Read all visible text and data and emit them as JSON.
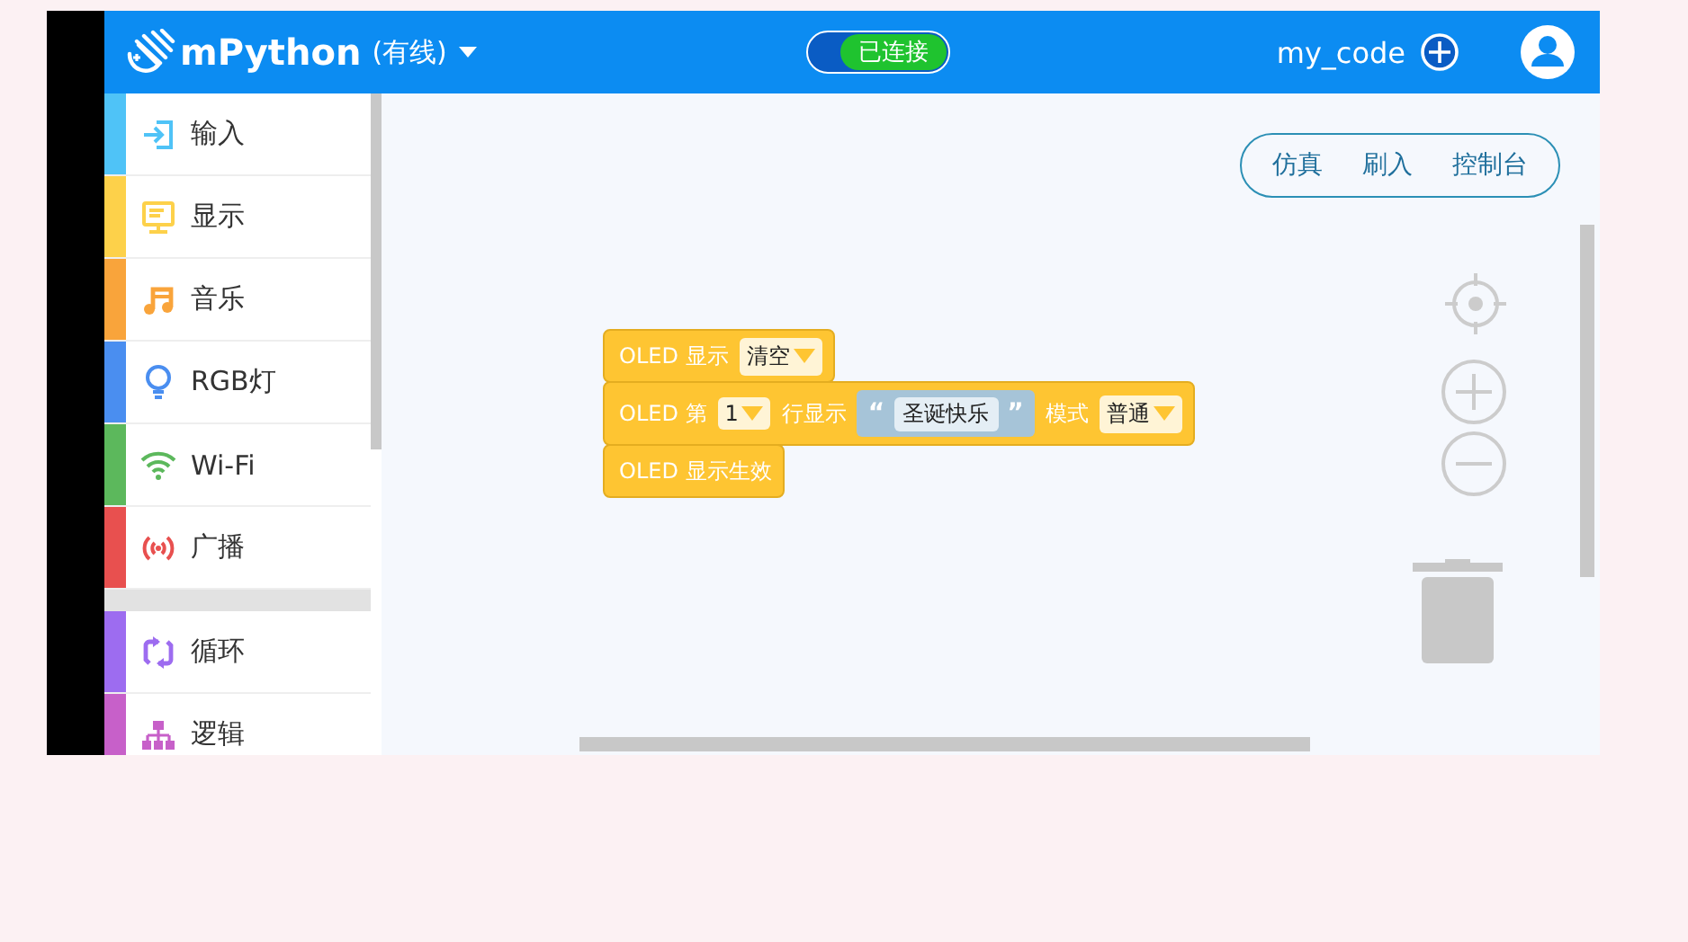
{
  "header": {
    "title": "mPython",
    "mode": "(有线)",
    "connection": {
      "label": "已连接",
      "on": true
    },
    "file_name": "my_code"
  },
  "sidebar": {
    "groups": [
      {
        "items": [
          {
            "label": "输入",
            "kind": "input",
            "color": "#4fc3f7",
            "selected": false
          },
          {
            "label": "显示",
            "kind": "display",
            "color": "#fdd14a",
            "selected": false
          },
          {
            "label": "音乐",
            "kind": "music",
            "color": "#f9a43b",
            "selected": false
          },
          {
            "label": "RGB灯",
            "kind": "bulb",
            "color": "#4a8ef0",
            "selected": false
          },
          {
            "label": "Wi-Fi",
            "kind": "wifi",
            "color": "#5cb85c",
            "selected": false
          },
          {
            "label": "广播",
            "kind": "broadcast",
            "color": "#e8504f",
            "selected": false
          }
        ]
      },
      {
        "items": [
          {
            "label": "循环",
            "kind": "loop",
            "color": "#9d6cf0",
            "selected": false
          },
          {
            "label": "逻辑",
            "kind": "logic",
            "color": "#c760c9",
            "selected": false
          }
        ]
      }
    ]
  },
  "toolbar": {
    "buttons": [
      "仿真",
      "刷入",
      "控制台"
    ]
  },
  "blocks": [
    {
      "parts": [
        {
          "kind": "text",
          "text": "OLED 显示"
        },
        {
          "kind": "dropdown",
          "text": "清空"
        }
      ]
    },
    {
      "parts": [
        {
          "kind": "text",
          "text": "OLED 第"
        },
        {
          "kind": "dropdown",
          "text": "1"
        },
        {
          "kind": "text",
          "text": "行显示"
        },
        {
          "kind": "string",
          "open": "“",
          "text": "圣诞快乐",
          "close": "”"
        },
        {
          "kind": "text",
          "text": "模式"
        },
        {
          "kind": "dropdown",
          "text": "普通"
        }
      ]
    },
    {
      "parts": [
        {
          "kind": "text",
          "text": "OLED 显示生效"
        }
      ]
    }
  ]
}
